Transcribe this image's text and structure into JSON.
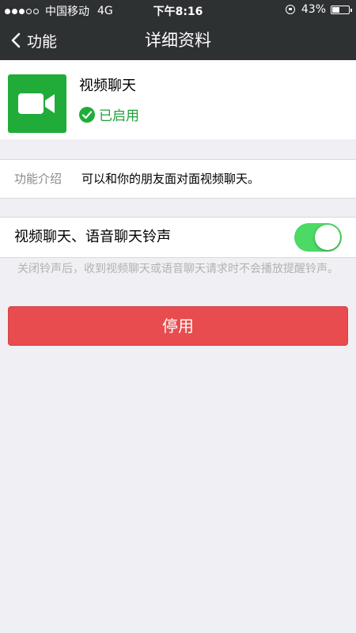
{
  "status_bar": {
    "signal_dots": [
      true,
      true,
      true,
      false,
      false
    ],
    "carrier": "中国移动",
    "network": "4G",
    "time": "下午8:16",
    "battery_percent": "43%",
    "battery_level": 0.43
  },
  "nav": {
    "back_label": "功能",
    "title": "详细资料"
  },
  "app": {
    "name": "视频聊天",
    "status": "已启用",
    "icon": "video-camera-icon",
    "icon_color": "#21ac39"
  },
  "intro": {
    "label": "功能介绍",
    "value": "可以和你的朋友面对面视频聊天。"
  },
  "ringtone": {
    "label": "视频聊天、语音聊天铃声",
    "enabled": true,
    "hint": "关闭铃声后，收到视频聊天或语音聊天请求时不会播放提醒铃声。"
  },
  "actions": {
    "disable_label": "停用",
    "disable_color": "#e94c4e"
  },
  "colors": {
    "header_bg": "#2e3132",
    "toggle_on": "#4cd964",
    "status_green": "#21a03a"
  }
}
